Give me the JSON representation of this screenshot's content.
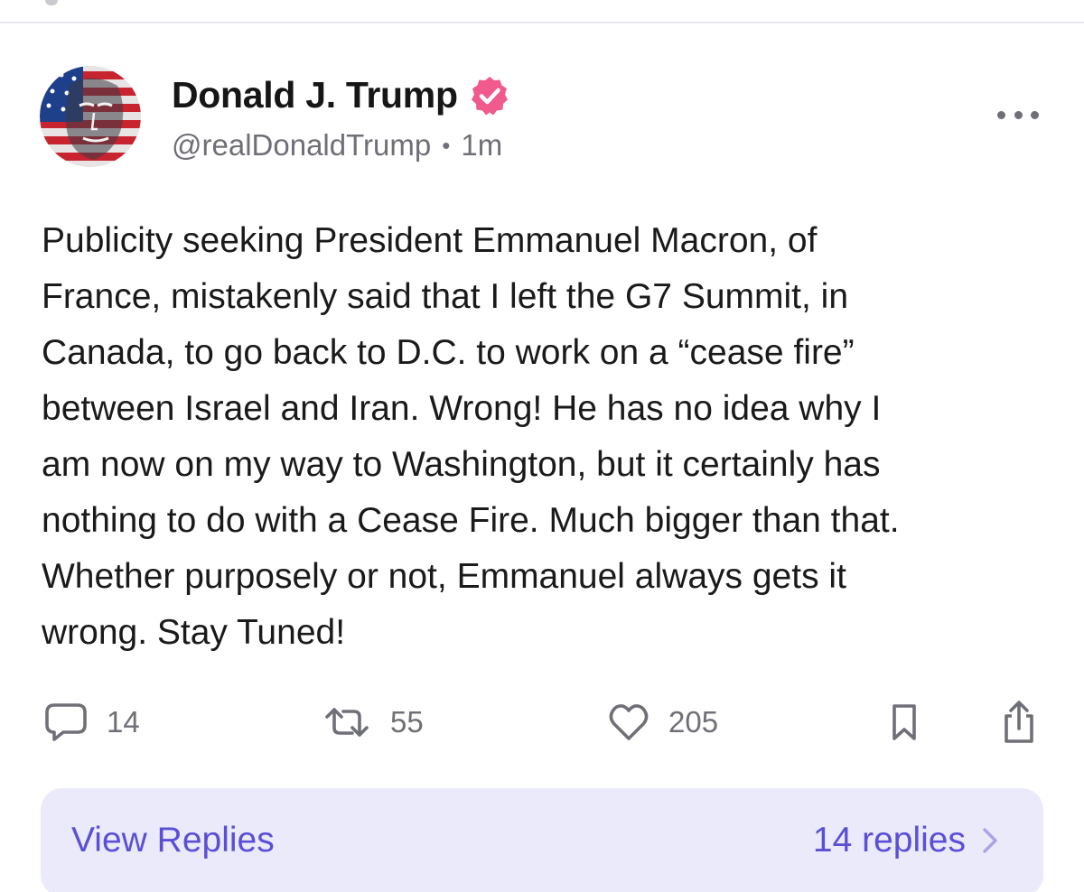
{
  "post": {
    "author": {
      "name": "Donald J. Trump",
      "handle": "@realDonaldTrump",
      "verified_icon": "verified-badge-icon",
      "verified_color": "#f05a8c"
    },
    "meta_separator": "•",
    "time": "1m",
    "more_icon": "more-horizontal-icon",
    "body_lines": [
      "Publicity seeking President Emmanuel Macron, of",
      "France, mistakenly said that I left the G7 Summit, in",
      "Canada, to go back to D.C. to work on a “cease fire”",
      "between Israel and Iran. Wrong! He has no idea why I",
      "am now on my way to Washington, but it certainly has",
      "nothing to do with a Cease Fire. Much bigger than that.",
      "Whether purposely or not, Emmanuel always gets it",
      "wrong. Stay Tuned!"
    ],
    "actions": {
      "replies": {
        "icon": "reply-bubble-icon",
        "count": "14"
      },
      "reposts": {
        "icon": "repost-icon",
        "count": "55"
      },
      "likes": {
        "icon": "heart-icon",
        "count": "205"
      },
      "bookmark": {
        "icon": "bookmark-icon"
      },
      "share": {
        "icon": "share-icon"
      }
    },
    "view_replies": {
      "label": "View Replies",
      "count_label": "14 replies",
      "icon": "chevron-right-icon",
      "accent_color": "#5b4fd6",
      "background_color": "#eaeafb"
    }
  }
}
